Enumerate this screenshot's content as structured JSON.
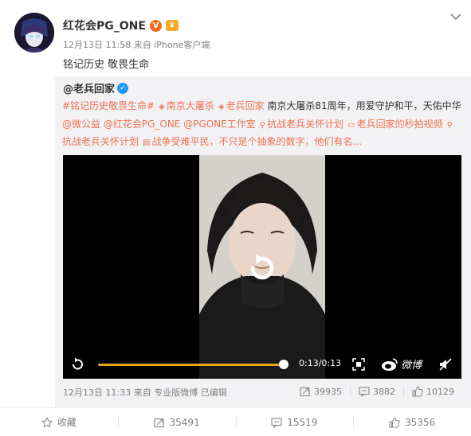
{
  "post": {
    "username": "红花会PG_ONE",
    "vip_badge": "V",
    "timestamp": "12月13日 11:58",
    "source": "来自 iPhone客户端",
    "text": "铭记历史 敬畏生命"
  },
  "repost": {
    "original_user": "@老兵回家",
    "segments": [
      {
        "text": "#铭记历史敬畏生命#",
        "type": "link"
      },
      {
        "text": "南京大屠杀",
        "type": "topic"
      },
      {
        "text": "老兵回家",
        "type": "topic"
      },
      {
        "text": " 南京大屠杀81周年，用爱守护和平，天佑中华",
        "type": "plain"
      },
      {
        "text": "@微公益",
        "type": "link"
      },
      {
        "text": " ",
        "type": "plain"
      },
      {
        "text": "@红花会PG_ONE",
        "type": "link"
      },
      {
        "text": " ",
        "type": "plain"
      },
      {
        "text": "@PGONE工作室",
        "type": "link"
      },
      {
        "text": "抗战老兵关怀计划",
        "type": "tag"
      },
      {
        "text": "老兵回家的秒拍视频",
        "type": "video"
      },
      {
        "text": "抗战老兵关怀计划",
        "type": "tag"
      },
      {
        "text": "战争受难平民，不只是个抽象的数字，他们有名...",
        "type": "doc"
      }
    ],
    "video": {
      "time": "0:13/0:13",
      "progress": 1.0,
      "brand": "微博"
    },
    "meta": {
      "timestamp": "12月13日 11:33",
      "source": "来自 专业版微博",
      "edited": "已编辑"
    },
    "actions": {
      "reposts": "39935",
      "comments": "3882",
      "likes": "10129"
    }
  },
  "bottom": {
    "favorite": "收藏",
    "reposts": "35491",
    "comments": "15519",
    "likes": "35356"
  },
  "colors": {
    "link": "#eb7350",
    "progress": "#e8a317",
    "vip": "#f26b1d"
  }
}
